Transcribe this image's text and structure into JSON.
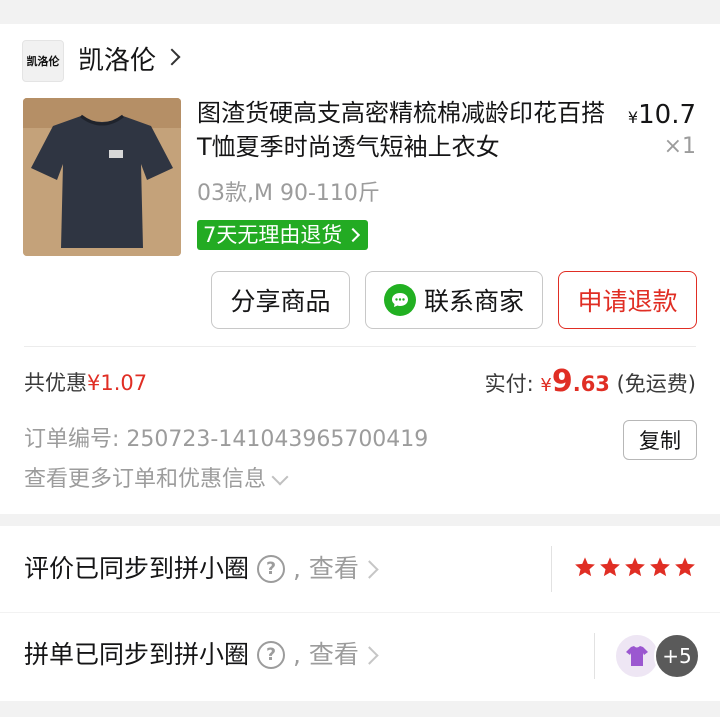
{
  "shop": {
    "logo_text": "凯洛伦",
    "name": "凯洛伦"
  },
  "product": {
    "title": "图渣货硬高支高密精梳棉减龄印花百搭T恤夏季时尚透气短袖上衣女",
    "price_currency": "¥",
    "price_int": "10",
    "price_dec": ".7",
    "quantity": "×1",
    "spec": "03款,M 90-110斤",
    "badge": "7天无理由退货"
  },
  "actions": {
    "share": "分享商品",
    "contact": "联系商家",
    "refund": "申请退款"
  },
  "summary": {
    "discount_label": "共优惠",
    "discount_amount": "¥1.07",
    "paid_label": "实付:",
    "paid_currency": "¥",
    "paid_int": "9",
    "paid_dec": ".63",
    "shipping": "(免运费)"
  },
  "order": {
    "number_label": "订单编号:",
    "number": "250723-141043965700419",
    "copy": "复制",
    "more": "查看更多订单和优惠信息"
  },
  "review": {
    "label": "评价已同步到拼小圈",
    "view": "查看",
    "rating": 5
  },
  "group": {
    "label": "拼单已同步到拼小圈",
    "view": "查看",
    "more_count": "+5"
  },
  "colors": {
    "accent": "#e02e24",
    "green": "#23ab23",
    "wechat": "#22b022"
  }
}
